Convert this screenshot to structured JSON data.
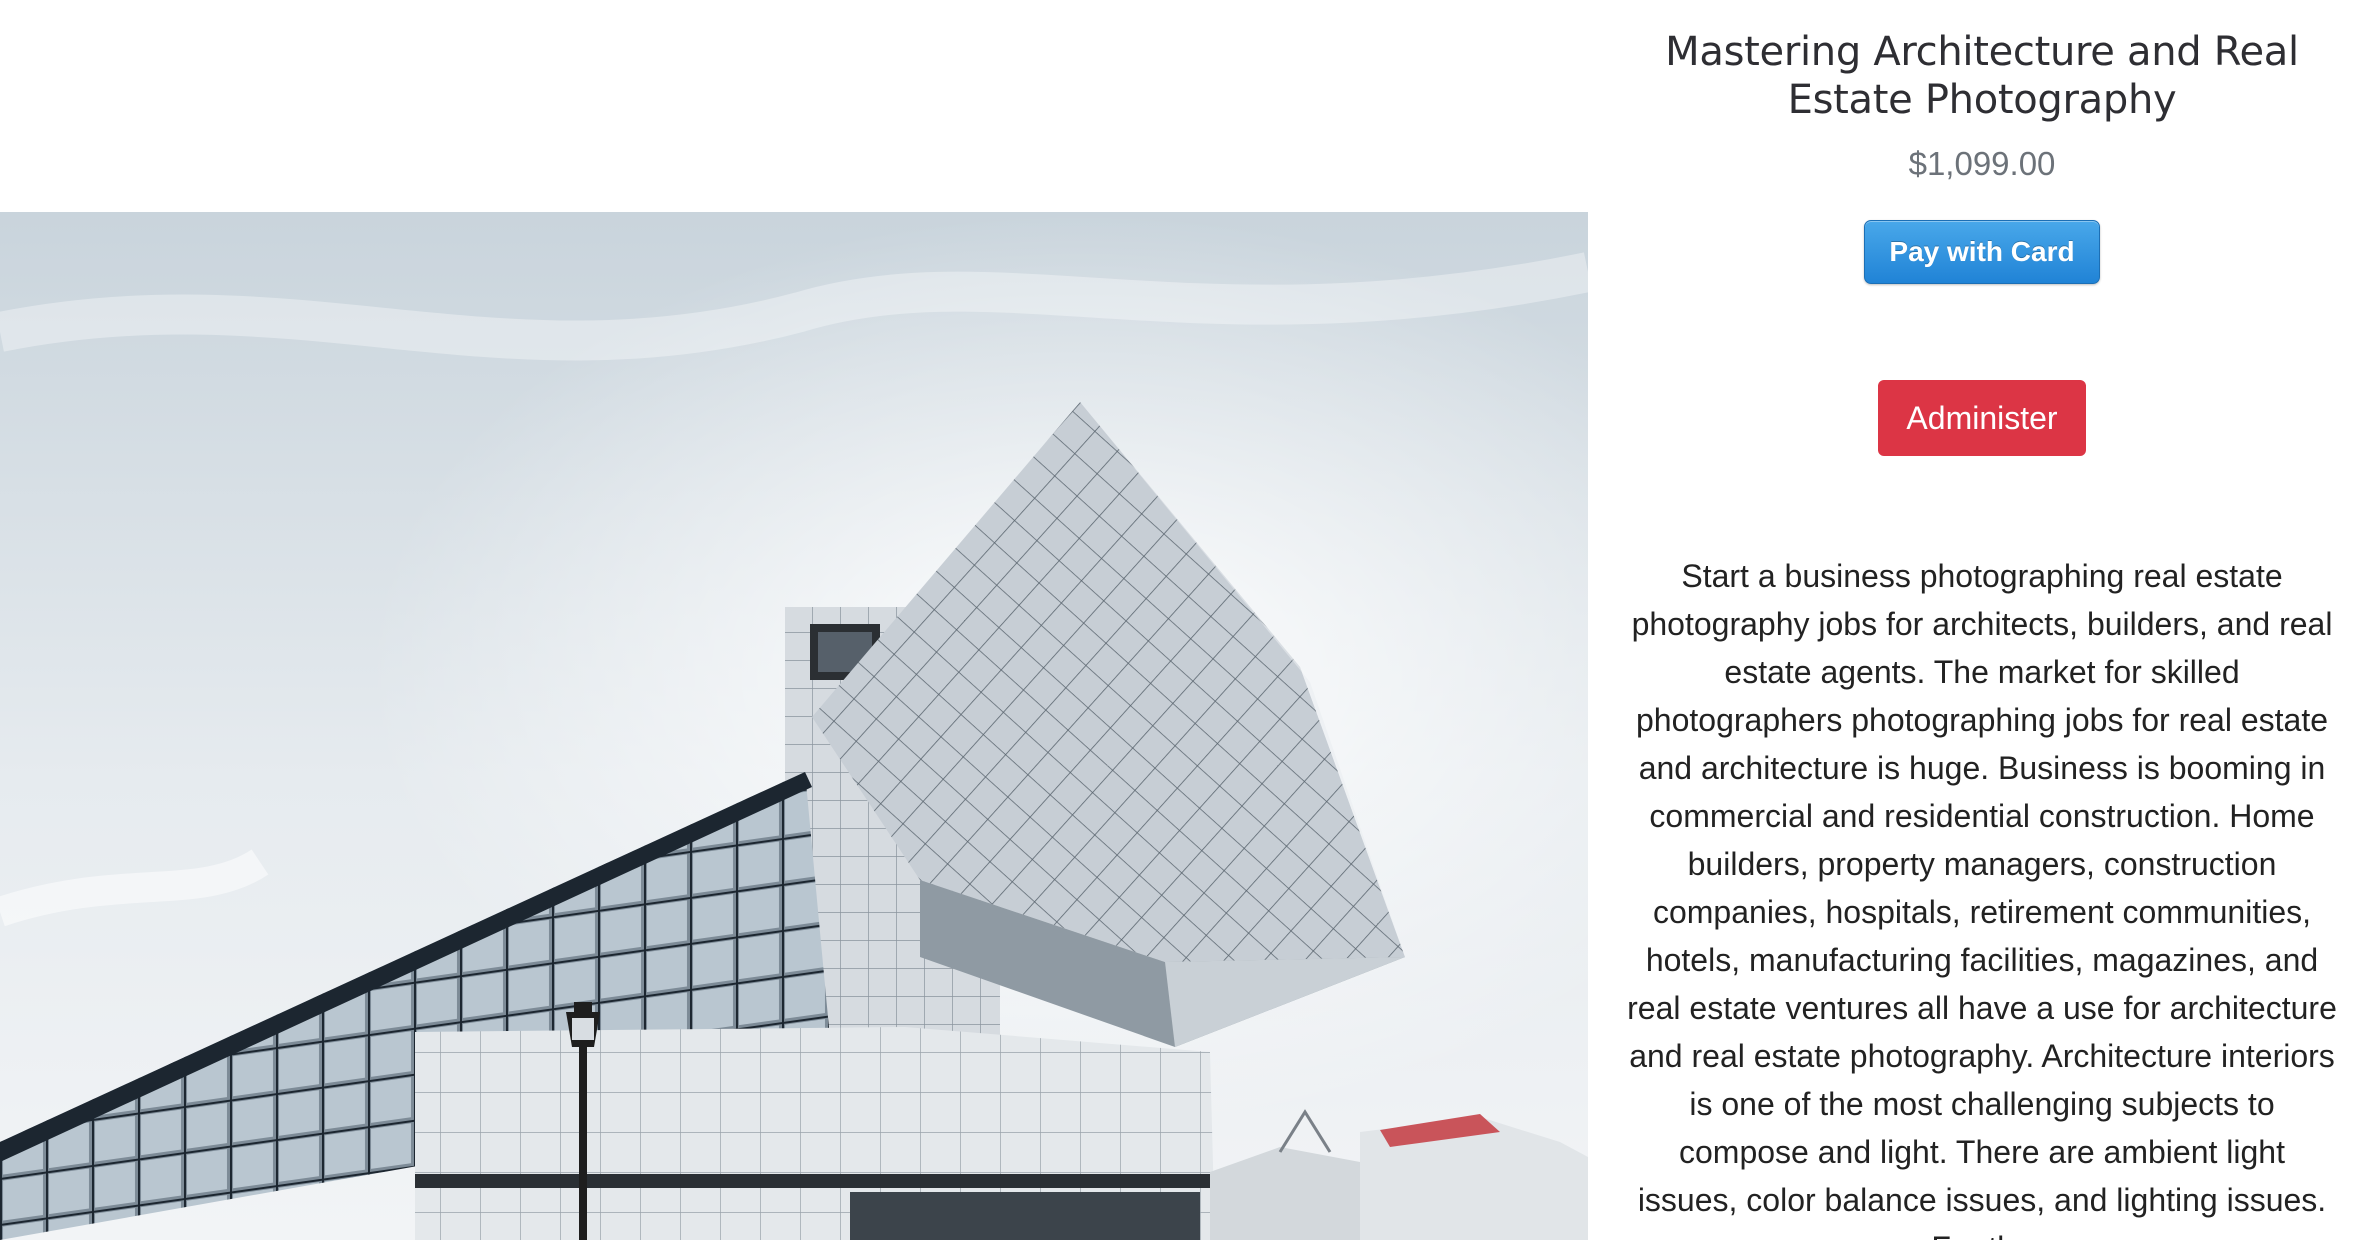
{
  "product": {
    "title": "Mastering Architecture and Real Estate Photography",
    "price": "$1,099.00",
    "pay_button_label": "Pay with Card",
    "admin_button_label": "Administer",
    "description": "Start a business photographing real estate photography jobs for architects, builders, and real estate agents. The market for skilled photographers photographing jobs for real estate and architecture is huge. Business is booming in commercial and residential construction. Home builders, property managers, construction companies, hospitals, retirement communities, hotels, manufacturing facilities, magazines, and real estate ventures all have a use for architecture and real estate photography. Architecture interiors is one of the most challenging subjects to compose and light. There are ambient light issues, color balance issues, and lighting issues. For the"
  },
  "colors": {
    "pay_button": "#2a8fdf",
    "admin_button": "#dc3545",
    "price_text": "#6c7279"
  },
  "hero_image": {
    "icon": "modern-glass-building-photo"
  }
}
